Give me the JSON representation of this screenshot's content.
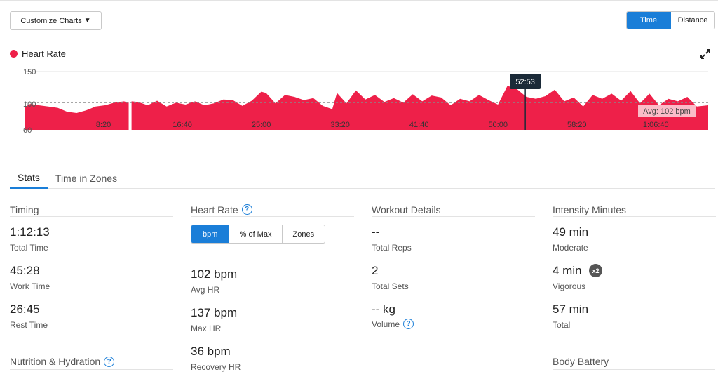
{
  "toolbar": {
    "customize_label": "Customize Charts"
  },
  "axis_toggle": {
    "time_label": "Time",
    "distance_label": "Distance",
    "selected": "Time"
  },
  "chart": {
    "legend_label": "Heart Rate",
    "series_color": "#ee2049",
    "accent_color": "#1a7ed8",
    "cursor_label": "52:53",
    "avg_label": "Avg: 102 bpm"
  },
  "chart_data": {
    "type": "area",
    "x_unit": "minutes",
    "y_ticks": [
      "150",
      "100",
      "60"
    ],
    "ylim": [
      60,
      150
    ],
    "x_ticks": [
      "8:20",
      "16:40",
      "25:00",
      "33:20",
      "41:40",
      "50:00",
      "58:20",
      "1:06:40"
    ],
    "x_tick_minutes": [
      8.333,
      16.667,
      25,
      33.333,
      41.667,
      50,
      58.333,
      66.667
    ],
    "xlim": [
      0,
      72.2
    ],
    "reference_line": 102,
    "cursor_minute": 52.883,
    "gaps": [
      [
        11.0,
        11.3
      ]
    ],
    "x": [
      0,
      0.6,
      1.5,
      2.5,
      3.5,
      4.5,
      5.5,
      6.5,
      7.5,
      8.5,
      9.5,
      10.5,
      11.0,
      11.3,
      12,
      13,
      14,
      15,
      16,
      17,
      18,
      19,
      20,
      21,
      22,
      23,
      24,
      25,
      25.5,
      26.5,
      27.5,
      28.5,
      29.5,
      30.5,
      31.5,
      32.5,
      33,
      34,
      35,
      36,
      37,
      38,
      39,
      40,
      41,
      42,
      43,
      44,
      45,
      46,
      47,
      48,
      49,
      50,
      51,
      52,
      53,
      54,
      55,
      56,
      57,
      58,
      59,
      60,
      61,
      62,
      63,
      64,
      65,
      66,
      67,
      68,
      69,
      70,
      71,
      72.2
    ],
    "values": [
      95,
      100,
      98,
      96,
      94,
      88,
      86,
      90,
      96,
      98,
      102,
      104,
      102,
      104,
      103,
      98,
      105,
      96,
      102,
      99,
      104,
      98,
      101,
      107,
      106,
      97,
      105,
      119,
      117,
      101,
      114,
      111,
      106,
      109,
      97,
      92,
      117,
      101,
      121,
      107,
      114,
      103,
      109,
      102,
      115,
      104,
      113,
      110,
      98,
      108,
      104,
      114,
      106,
      99,
      128,
      123,
      111,
      108,
      112,
      122,
      104,
      110,
      96,
      114,
      108,
      116,
      105,
      120,
      101,
      116,
      98,
      108,
      104,
      111,
      96,
      98
    ]
  },
  "tabs": [
    {
      "label": "Stats"
    },
    {
      "label": "Time in Zones"
    }
  ],
  "timing": {
    "title": "Timing",
    "total_time": {
      "value": "1:12:13",
      "label": "Total Time"
    },
    "work_time": {
      "value": "45:28",
      "label": "Work Time"
    },
    "rest_time": {
      "value": "26:45",
      "label": "Rest Time"
    }
  },
  "heart_rate": {
    "title": "Heart Rate",
    "modes": [
      "bpm",
      "% of Max",
      "Zones"
    ],
    "avg": {
      "value": "102 bpm",
      "label": "Avg HR"
    },
    "max": {
      "value": "137 bpm",
      "label": "Max HR"
    },
    "recovery": {
      "value": "36 bpm",
      "label": "Recovery HR"
    }
  },
  "workout": {
    "title": "Workout Details",
    "reps": {
      "value": "--",
      "label": "Total Reps"
    },
    "sets": {
      "value": "2",
      "label": "Total Sets"
    },
    "volume": {
      "value": "-- kg",
      "label": "Volume"
    }
  },
  "intensity": {
    "title": "Intensity Minutes",
    "moderate": {
      "value": "49 min",
      "label": "Moderate"
    },
    "vigorous": {
      "value": "4 min",
      "label": "Vigorous",
      "badge": "x2"
    },
    "total": {
      "value": "57 min",
      "label": "Total"
    }
  },
  "sections": {
    "nutrition": "Nutrition & Hydration",
    "body_battery": "Body Battery"
  },
  "icons": {
    "help": "question-circle-icon",
    "expand": "expand-arrows-icon",
    "caret": "caret-down-icon"
  }
}
